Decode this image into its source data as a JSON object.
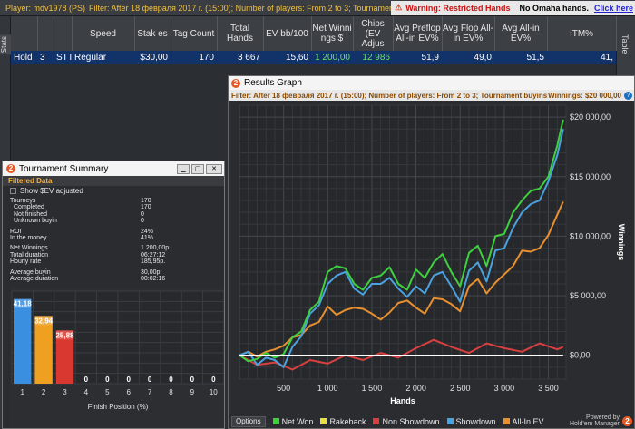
{
  "topbar": {
    "player": "Player: mdv1978 (PS)",
    "filter": "Filter: After 18 февраля 2017 г. (15:00); Number of players: From 2 to 3; Tournament buyins: $28,20+$1,80",
    "warning": "Warning: Restricted Hands",
    "omaha": "No Omaha hands.",
    "click_here": "Click here"
  },
  "side_tabs": {
    "left": "Stats",
    "right": "Table"
  },
  "stats_table": {
    "headers": [
      "",
      "",
      "",
      "Speed",
      "Stak es",
      "Tag Count",
      "Total Hands",
      "EV bb/100",
      "Net Winni ngs $",
      "Chips (EV Adjus",
      "Avg Preflop All-in EV%",
      "Avg Flop All-in EV%",
      "Avg All-in EV%",
      "ITM%"
    ],
    "row": [
      "Hold",
      "3",
      "STT",
      "Regular",
      "$30,00",
      "170",
      "3 667",
      "15,60",
      "1 200,00",
      "12 986",
      "51,9",
      "49,0",
      "51,5",
      "41,"
    ]
  },
  "results_graph": {
    "title": "Results Graph",
    "filter": "Filter: After 18 февраля 2017 г. (15:00); Number of players: From 2 to 3; Tournament buyins: $28,20+$1,80",
    "winnings_label": "Winnings: $20 000,00",
    "help": "?",
    "options_label": "Options",
    "powered_by": "Powered by",
    "brand": "Hold'em Manager",
    "logo_char": "2"
  },
  "tournament_summary": {
    "title": "Tournament Summary",
    "filtered_label": "Filtered Data",
    "ev_checkbox": "Show $EV adjusted",
    "rows": [
      {
        "k": "Tourneys",
        "v": "170",
        "indent": false,
        "gap": false
      },
      {
        "k": "Completed",
        "v": "170",
        "indent": true,
        "gap": false
      },
      {
        "k": "Not finished",
        "v": "0",
        "indent": true,
        "gap": false
      },
      {
        "k": "Unknown buyin",
        "v": "0",
        "indent": true,
        "gap": false
      },
      {
        "k": "ROI",
        "v": "24%",
        "indent": false,
        "gap": true
      },
      {
        "k": "In the money",
        "v": "41%",
        "indent": false,
        "gap": false
      },
      {
        "k": "Net Winnings",
        "v": "1 200,00р.",
        "indent": false,
        "gap": true
      },
      {
        "k": "Total duration",
        "v": "06:27:12",
        "indent": false,
        "gap": false
      },
      {
        "k": "Hourly rate",
        "v": "185,95р.",
        "indent": false,
        "gap": false
      },
      {
        "k": "Average buyin",
        "v": "30,00р.",
        "indent": false,
        "gap": true
      },
      {
        "k": "Average duration",
        "v": "00:02:16",
        "indent": false,
        "gap": false
      }
    ]
  },
  "chart_data": [
    {
      "type": "line",
      "xlabel": "Hands",
      "ylabel": "Winnings",
      "xlim": [
        0,
        3700
      ],
      "ylim": [
        -2000,
        21000
      ],
      "x_ticks": [
        {
          "v": 500,
          "label": "500"
        },
        {
          "v": 1000,
          "label": "1 000"
        },
        {
          "v": 1500,
          "label": "1 500"
        },
        {
          "v": 2000,
          "label": "2 000"
        },
        {
          "v": 2500,
          "label": "2 500"
        },
        {
          "v": 3000,
          "label": "3 000"
        },
        {
          "v": 3500,
          "label": "3 500"
        }
      ],
      "y_ticks": [
        {
          "v": 0,
          "label": "$0,00"
        },
        {
          "v": 5000,
          "label": "$5 000,00"
        },
        {
          "v": 10000,
          "label": "$10 000,00"
        },
        {
          "v": 15000,
          "label": "$15 000,00"
        },
        {
          "v": 20000,
          "label": "$20 000,00"
        }
      ],
      "grid": true,
      "legend": "bottom",
      "series": [
        {
          "name": "Net Won",
          "color": "#3fd03f",
          "x": [
            0,
            100,
            200,
            300,
            400,
            500,
            600,
            700,
            800,
            900,
            1000,
            1100,
            1200,
            1300,
            1400,
            1500,
            1600,
            1700,
            1800,
            1900,
            2000,
            2100,
            2200,
            2300,
            2400,
            2500,
            2600,
            2700,
            2800,
            2900,
            3000,
            3100,
            3200,
            3300,
            3400,
            3500,
            3600,
            3667
          ],
          "y": [
            0,
            -500,
            -300,
            200,
            -200,
            100,
            1500,
            2000,
            3800,
            4500,
            7000,
            7500,
            7300,
            6000,
            5500,
            6500,
            6700,
            7400,
            6000,
            5500,
            7200,
            6500,
            7800,
            8500,
            7000,
            5800,
            8600,
            9200,
            7500,
            10000,
            10200,
            12000,
            13000,
            13800,
            14000,
            15000,
            17600,
            19800
          ]
        },
        {
          "name": "Rakeback",
          "color": "#e8e040",
          "x": [
            0,
            3667
          ],
          "y": [
            0,
            0
          ]
        },
        {
          "name": "Non Showdown",
          "color": "#d84040",
          "x": [
            0,
            200,
            400,
            600,
            800,
            1000,
            1200,
            1400,
            1600,
            1800,
            2000,
            2200,
            2400,
            2600,
            2800,
            3000,
            3200,
            3400,
            3600,
            3667
          ],
          "y": [
            0,
            -800,
            -600,
            -1200,
            -400,
            -700,
            0,
            -400,
            200,
            -200,
            600,
            1300,
            700,
            200,
            1000,
            600,
            300,
            1000,
            500,
            700
          ]
        },
        {
          "name": "Showdown",
          "color": "#4aa2e0",
          "x": [
            0,
            100,
            200,
            300,
            400,
            500,
            600,
            700,
            800,
            900,
            1000,
            1100,
            1200,
            1300,
            1400,
            1500,
            1600,
            1700,
            1800,
            1900,
            2000,
            2100,
            2200,
            2300,
            2400,
            2500,
            2600,
            2700,
            2800,
            2900,
            3000,
            3100,
            3200,
            3300,
            3400,
            3500,
            3600,
            3667
          ],
          "y": [
            0,
            300,
            -800,
            -200,
            -400,
            -1000,
            700,
            1600,
            3500,
            4200,
            6000,
            6700,
            7000,
            5600,
            5100,
            6000,
            6000,
            6500,
            5600,
            4900,
            5800,
            5200,
            6700,
            7000,
            5800,
            4500,
            7100,
            7800,
            6200,
            8800,
            9000,
            10700,
            12000,
            12700,
            13000,
            14600,
            16800,
            19000
          ]
        },
        {
          "name": "All-In EV",
          "color": "#e89030",
          "x": [
            0,
            100,
            200,
            300,
            400,
            500,
            600,
            700,
            800,
            900,
            1000,
            1100,
            1200,
            1300,
            1400,
            1500,
            1600,
            1700,
            1800,
            1900,
            2000,
            2100,
            2200,
            2300,
            2400,
            2500,
            2600,
            2700,
            2800,
            2900,
            3000,
            3100,
            3200,
            3300,
            3400,
            3500,
            3600,
            3667
          ],
          "y": [
            0,
            300,
            -100,
            300,
            500,
            800,
            1500,
            1700,
            2500,
            2800,
            4100,
            3400,
            3800,
            4000,
            3900,
            3500,
            3000,
            3600,
            4400,
            4600,
            4000,
            3500,
            4800,
            4700,
            4300,
            3700,
            5800,
            6400,
            5200,
            6100,
            6800,
            7500,
            8800,
            8700,
            9000,
            10100,
            11800,
            12900
          ]
        }
      ]
    },
    {
      "type": "bar",
      "xlabel": "Finish Position (%)",
      "categories": [
        "1",
        "2",
        "3",
        "4",
        "5",
        "6",
        "7",
        "8",
        "9",
        "10"
      ],
      "values": [
        41.18,
        32.94,
        25.88,
        0,
        0,
        0,
        0,
        0,
        0,
        0
      ],
      "value_labels": [
        "41,18",
        "32,94",
        "25,88",
        "0",
        "0",
        "0",
        "0",
        "0",
        "0",
        "0"
      ],
      "colors": [
        "#3a8fe0",
        "#f0a020",
        "#d83830"
      ],
      "ylim": [
        0,
        45
      ],
      "grid": true
    }
  ]
}
